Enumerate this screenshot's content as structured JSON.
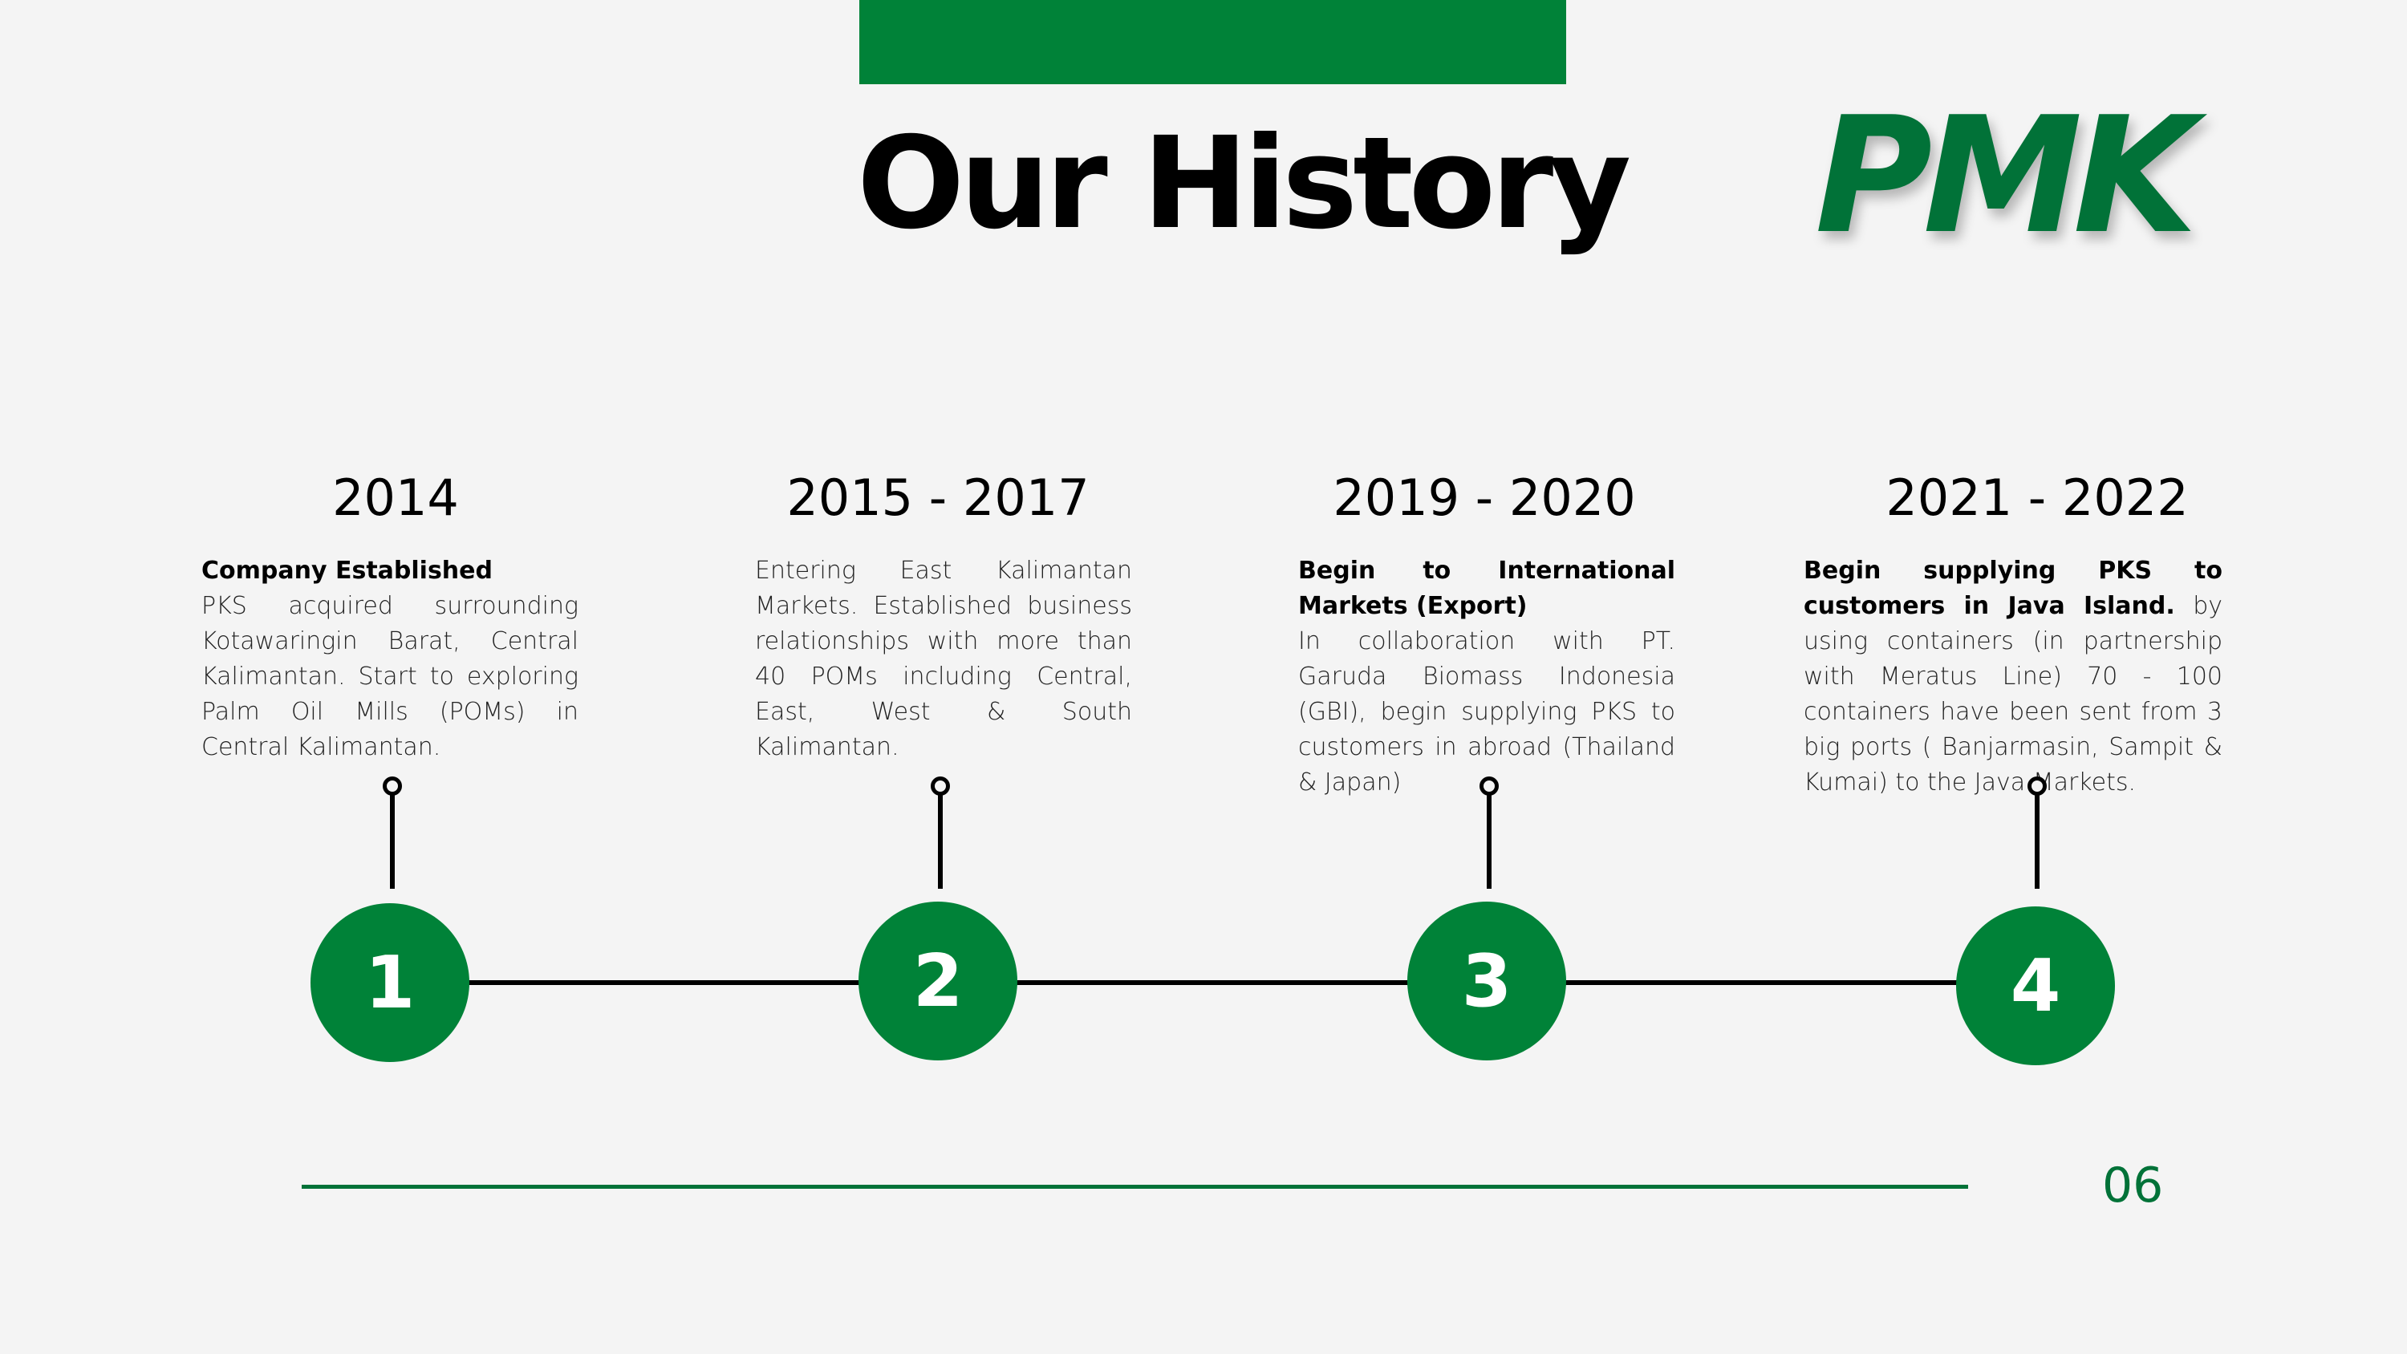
{
  "header": {
    "title": "Our History",
    "logo_text": "PMK"
  },
  "timeline": [
    {
      "number": "1",
      "year": "2014",
      "heading": "Company Established",
      "text": "PKS acquired surrounding Kotawaringin Barat, Central Kalimantan. Start to exploring Palm Oil Mills (POMs) in Central Kalimantan."
    },
    {
      "number": "2",
      "year": "2015 - 2017",
      "heading": "",
      "text": "Entering East Kalimantan Markets. Established business relationships with more than 40 POMs including Central, East, West & South Kalimantan."
    },
    {
      "number": "3",
      "year": "2019 - 2020",
      "heading": "Begin to International Markets (Export)",
      "text": "In collaboration with PT. Garuda Biomass Indonesia (GBI), begin supplying PKS to customers in abroad (Thailand & Japan)"
    },
    {
      "number": "4",
      "year": "2021 - 2022",
      "heading": "Begin supplying PKS to customers in Java Island.",
      "text": "by using containers (in partnership with Meratus Line) 70 - 100 containers have been sent from 3 big ports ( Banjarmasin, Sampit & Kumai) to the Java Markets."
    }
  ],
  "footer": {
    "page_number": "06"
  },
  "colors": {
    "accent_green": "#008238",
    "logo_green": "#017238",
    "background": "#f4f4f4"
  }
}
